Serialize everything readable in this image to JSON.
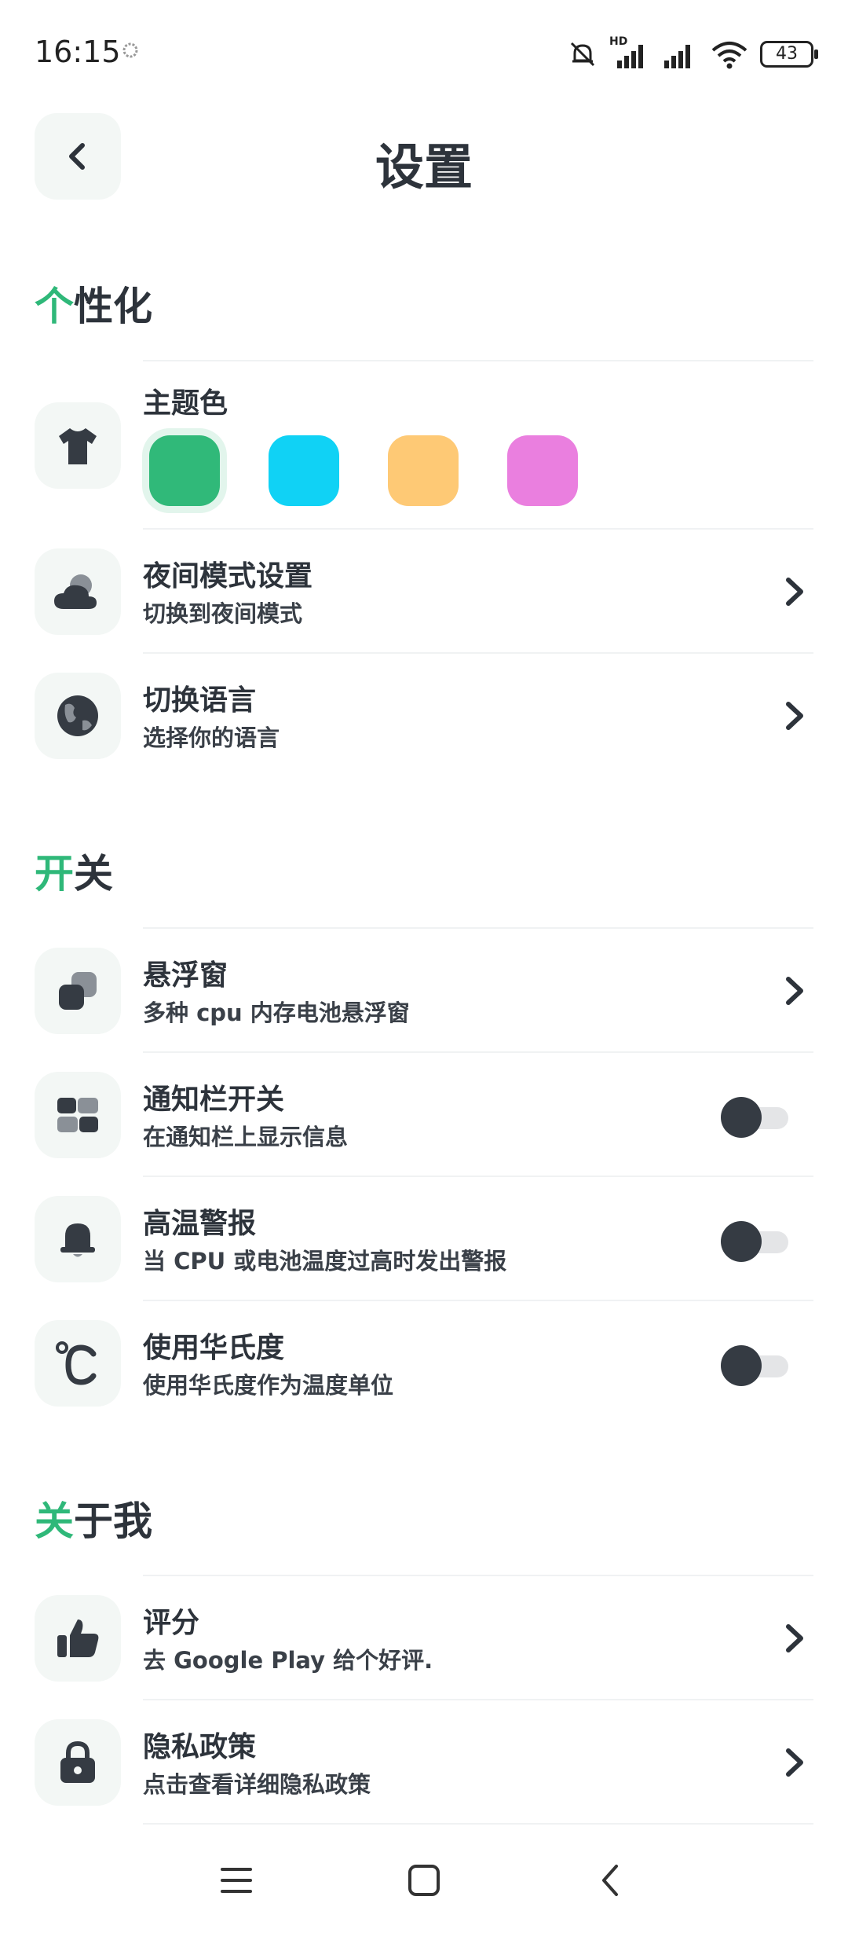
{
  "status_bar": {
    "time": "16:15",
    "network_label": "HD",
    "battery_level": "43"
  },
  "header": {
    "title": "设置"
  },
  "sections": [
    {
      "accent_char": "个",
      "rest": "性化"
    },
    {
      "accent_char": "开",
      "rest": "关"
    },
    {
      "accent_char": "关",
      "rest": "于我"
    }
  ],
  "theme": {
    "label": "主题色",
    "colors": [
      "#30b979",
      "#10d2f5",
      "#fec975",
      "#ea7fdf"
    ],
    "selected_index": 0
  },
  "rows": {
    "night_mode": {
      "title": "夜间模式设置",
      "subtitle": "切换到夜间模式"
    },
    "language": {
      "title": "切换语言",
      "subtitle": "选择你的语言"
    },
    "float_window": {
      "title": "悬浮窗",
      "subtitle": "多种 cpu 内存电池悬浮窗"
    },
    "notification_switch": {
      "title": "通知栏开关",
      "subtitle": "在通知栏上显示信息",
      "enabled": false
    },
    "high_temp_alarm": {
      "title": "高温警报",
      "subtitle": "当 CPU 或电池温度过高时发出警报",
      "enabled": false
    },
    "fahrenheit": {
      "title": "使用华氏度",
      "subtitle": "使用华氏度作为温度单位",
      "enabled": false
    },
    "rate": {
      "title": "评分",
      "subtitle": "去 Google Play 给个好评."
    },
    "privacy": {
      "title": "隐私政策",
      "subtitle": "点击查看详细隐私政策"
    }
  },
  "colors": {
    "accent": "#2fb879",
    "icon_bg": "#f3f7f5",
    "text": "#2d333b"
  }
}
